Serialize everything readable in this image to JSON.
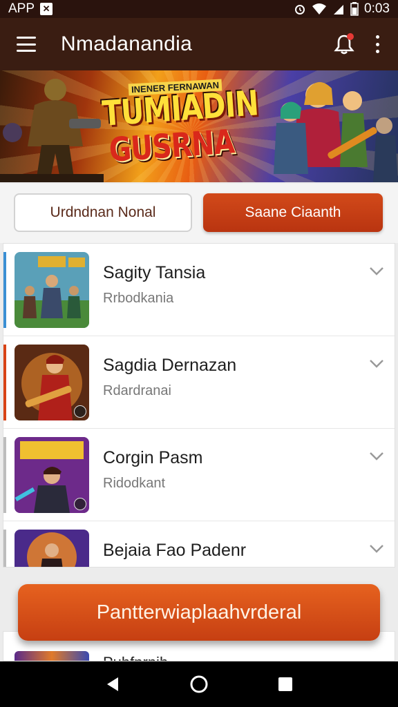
{
  "status_bar": {
    "app_label": "APP",
    "time": "0:03"
  },
  "app_bar": {
    "title": "Nmadanandia"
  },
  "banner": {
    "subtitle": "INENER FERNAWAN",
    "title_line1": "TUMIADIN",
    "title_line2": "GUSRNA"
  },
  "tabs": {
    "left_label": "Urdndnan Nonal",
    "right_label": "Saane Ciaanth"
  },
  "list": {
    "items": [
      {
        "title": "Sagity Tansia",
        "subtitle": "Rrbodkania",
        "accent": "#3a8fd4"
      },
      {
        "title": "Sagdia Dernazan",
        "subtitle": "Rdardranai",
        "accent": "#d84315"
      },
      {
        "title": "Corgin Pasm",
        "subtitle": "Ridodkant",
        "accent": "#bdbdbd"
      },
      {
        "title": "Bejaia Fao Padenr",
        "subtitle": "",
        "accent": "#bdbdbd"
      }
    ]
  },
  "cta": {
    "label": "Pantterwiaplaahvrderal"
  },
  "peek_item": {
    "title": "Puhfnrnih"
  },
  "colors": {
    "app_bar": "#3a1d12",
    "accent_orange": "#c63f12"
  }
}
